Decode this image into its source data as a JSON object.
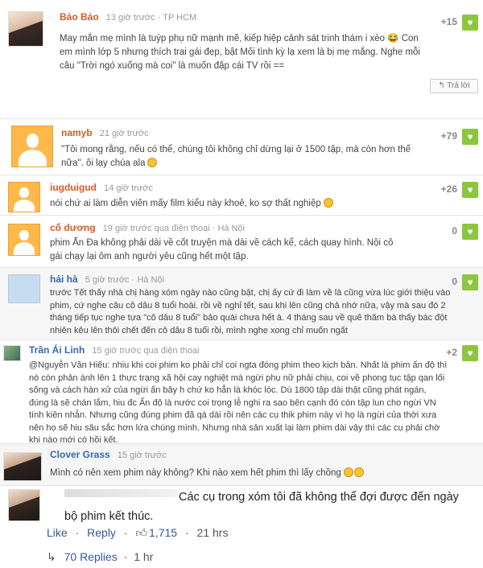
{
  "comments": [
    {
      "name": "Bảo Bảo",
      "meta": "13 giờ trước · TP HCM",
      "text": "May mắn mẹ mình là tuýp phụ nữ mạnh mẽ, kiếp hiệp cảnh sát trinh thám i xèo 😂 Con em mình lớp 5 nhưng thích trai gái đẹp, bật Mối tình kỳ lạ xem là bị mẹ mắng. Nghe mỗi câu \"Trời ngó xuống mà coi\" là muốn đập cái TV rồi ==",
      "score": "+15",
      "reply_label": "↰ Trả lời"
    },
    {
      "name": "namyb",
      "meta": "21 giờ trước",
      "text": "\"Tôi mong rằng, nếu có thể, chúng tôi không chỉ dừng lại ở 1500 tập, mà còn hơn thế nữa\". ôi lạy chúa ala",
      "score": "+79"
    },
    {
      "name": "iugduigud",
      "meta": "14 giờ trước",
      "text": "nói chứ ai làm diễn viên mấy film kiểu này khoẻ, ko sợ thất nghiệp",
      "score": "+26"
    },
    {
      "name": "cố dương",
      "meta": "19 giờ trước qua điện thoại · Hà Nội",
      "text": "phim Ấn Đa không phải dài về cốt truyện mà dài về cách kể, cách quay hình. Nội cô gái chạy lại ôm anh người yêu cũng hết một tập.",
      "score": "0"
    },
    {
      "name": "hải hà",
      "meta": "5 giờ trước · Hà Nội",
      "text": "trước Tết thấy nhà chị hàng xóm ngày nào cũng bật, chị ấy cứ đi làm về là cũng vừa lúc giới thiệu vào phim, cứ nghe câu cô dâu 8 tuổi hoài. rồi về nghỉ tết, sau khi lên cũng chả nhớ nữa, vậy mà sau đó 2 tháng tiếp tục nghe tựa \"cô dâu 8 tuổi\" bảo quái chưa hết à. 4 tháng sau về quê thăm bà thấy bác đột nhiên kêu lên thôi chết đến cô dâu 8 tuổi rồi, mình nghe xong chỉ muốn ngất",
      "score": "0"
    },
    {
      "name": "Trần Ái Linh",
      "meta": "15 giờ trước qua điện thoại",
      "text": "@Nguyễn Văn Hiếu: nhiu khi coi phim ko phải chỉ coi ngta đóng phim theo kịch bản. Nhất là phim ấn độ thì nó còn phản ánh lên 1 thực trạng xã hội cay nghiệt mà ngừi phụ nữ phải chịu, coi về phong tục tập qan lối sống và cách hàn xử của ngừi ấn bây h chứ ko hẳn là khóc lóc. Dù 1800 tập dài thật cũng phát ngán, đúng là sẽ chán lắm, hiu đc Ấn độ là nước coi trọng lễ nghi ra sao bên cạnh đó còn tập lun cho ngừi VN tính kiên nhẫn. Nhưng cũng đúng phim đã qá dài rồi nên các cụ thik phim này vì họ là ngừi của thời xưa nên họ sẽ hiu sâu sắc hơn lứa chúng mình. Nhưng nhà sản xuất lại làm phim dài vậy thì các cụ phải chờ khi nào mới có hồi kết.",
      "score": "+2"
    },
    {
      "name": "Clover Grass",
      "meta": "15 giờ trước",
      "text": "Mình có nên xem phim này không? Khi nào xem hết phim thì lấy chồng"
    }
  ],
  "facebook": {
    "text": "Các cụ trong xóm tôi đã không thể đợi được đến ngày bộ phim kết thúc.",
    "like_label": "Like",
    "dot": "·",
    "reply_label": "Reply",
    "thumbs_icon": "thumbs-up-icon",
    "likes_count": "1,715",
    "time": "21 hrs",
    "replies_label": "70 Replies",
    "replies_time": "1 hr"
  },
  "heart_icon": "heart-icon",
  "colors": {
    "heart": "#8cc63f",
    "username": "#d85a21",
    "username_blue": "#3767ad",
    "avatar_default": "#ffb94a"
  }
}
